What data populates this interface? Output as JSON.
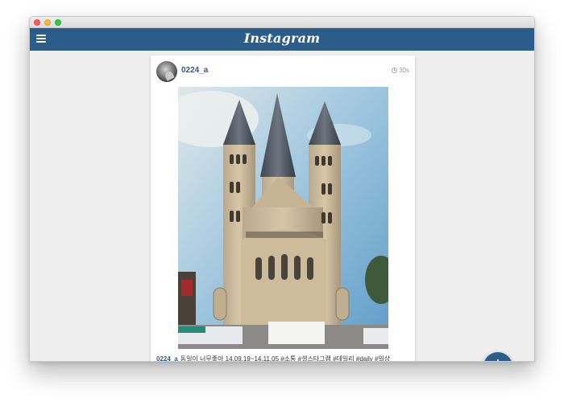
{
  "app": {
    "brand": "Instagram"
  },
  "post": {
    "username": "0224_a",
    "time": "30s",
    "caption_user": "0224_a",
    "caption_text": "동일이 너무좋아 14.09.19~14.11.05 #소통 #셀스타그램 #데일리 #daily #일상"
  },
  "fab": {
    "label": "+"
  },
  "colors": {
    "primary": "#2c5d8a",
    "background": "#eeeeee",
    "card": "#ffffff"
  },
  "icons": {
    "menu": "hamburger-menu-icon",
    "clock": "clock-icon",
    "add": "plus-icon"
  }
}
